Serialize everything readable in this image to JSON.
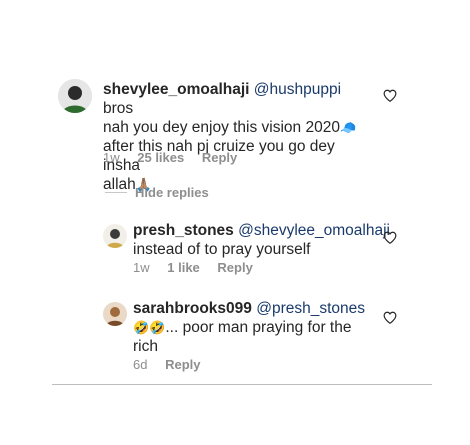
{
  "comments": [
    {
      "username": "shevylee_omoalhaji",
      "mention": "@hushpuppi",
      "text_line1_rest": " bros",
      "text_line2": "nah you dey enjoy this vision 2020",
      "text_line2_emoji": "🧢",
      "text_line3": "after this nah pj cruize you go dey insha",
      "text_line4": "allah",
      "text_line4_emoji": "🙏🏽",
      "time": "1w",
      "likes": "25 likes",
      "reply_label": "Reply"
    },
    {
      "username": "presh_stones",
      "mention": "@shevylee_omoalhaji",
      "text_line2": "instead of to pray yourself",
      "time": "1w",
      "likes": "1 like",
      "reply_label": "Reply"
    },
    {
      "username": "sarahbrooks099",
      "mention": "@presh_stones",
      "text_line2_emoji": "🤣🤣",
      "text_line2": "... poor man praying for the",
      "text_line3": "rich",
      "time": "6d",
      "reply_label": "Reply"
    }
  ],
  "hide_replies_label": "Hide replies",
  "icons": {
    "like": "heart-outline-icon"
  },
  "colors": {
    "text": "#262626",
    "meta": "#8e8e8e",
    "mention": "#1a3a6b"
  }
}
